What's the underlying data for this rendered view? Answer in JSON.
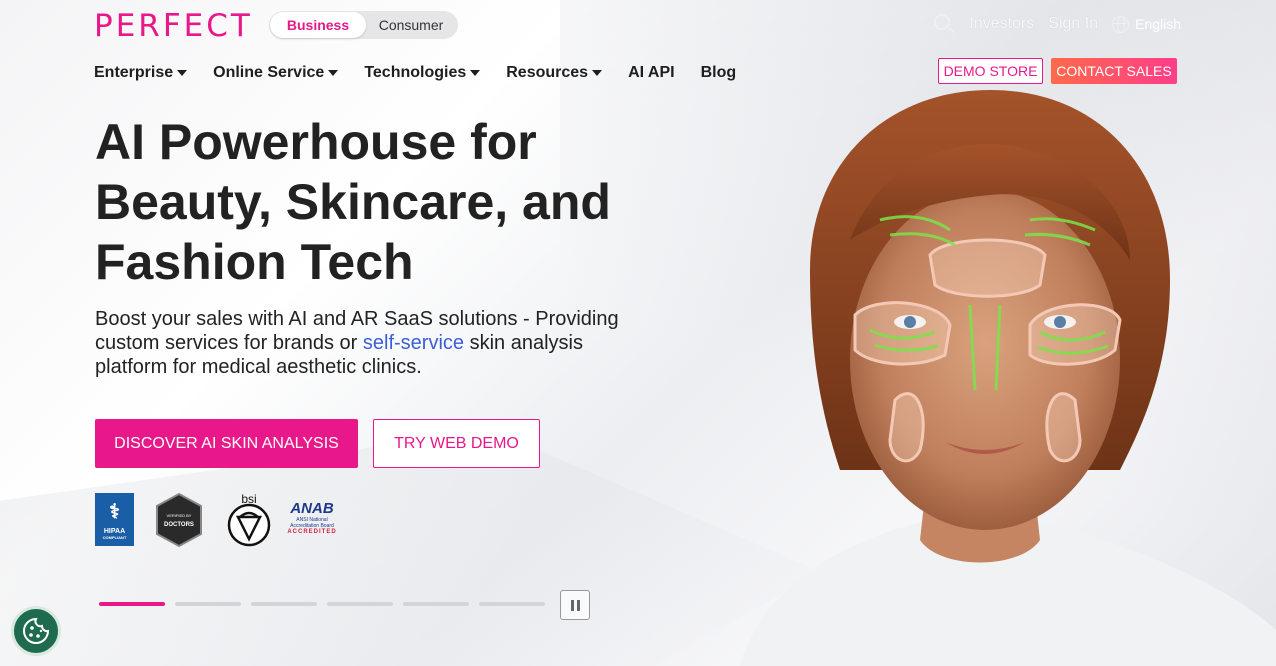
{
  "brand": {
    "logo": "PERFECT"
  },
  "segment": {
    "business": "Business",
    "consumer": "Consumer"
  },
  "topbar": {
    "investors": "Investors",
    "sign_in": "Sign In",
    "language": "English"
  },
  "nav": [
    {
      "label": "Enterprise",
      "dropdown": true
    },
    {
      "label": "Online Service",
      "dropdown": true
    },
    {
      "label": "Technologies",
      "dropdown": true
    },
    {
      "label": "Resources",
      "dropdown": true
    },
    {
      "label": "AI API",
      "dropdown": false
    },
    {
      "label": "Blog",
      "dropdown": false
    }
  ],
  "cta": {
    "demo_store": "DEMO STORE",
    "contact_sales": "CONTACT SALES"
  },
  "hero": {
    "headline_line1": "AI Powerhouse for",
    "headline_line2": "Beauty, Skincare, and",
    "headline_line3": "Fashion Tech",
    "sub_before": "Boost your sales with AI and AR SaaS solutions - Providing custom services for brands or ",
    "sub_link": "self-service",
    "sub_after": " skin analysis platform for medical aesthetic clinics.",
    "primary_button": "DISCOVER AI SKIN ANALYSIS",
    "secondary_button": "TRY WEB DEMO"
  },
  "badges": {
    "hipaa": "HIPAA",
    "hipaa_sub": "COMPLIANT",
    "doctors_top": "VERIFIED BY",
    "doctors": "DOCTORS",
    "bsi": "bsi",
    "anab": "ANAB",
    "anab_sub": "ANSI National Accreditation Board",
    "anab_accredited": "ACCREDITED"
  },
  "slider": {
    "count": 6,
    "active_index": 0
  },
  "colors": {
    "brand_pink": "#e8188a",
    "contact_gradient": "#ff5a73",
    "link_blue": "#3a5fd6"
  }
}
